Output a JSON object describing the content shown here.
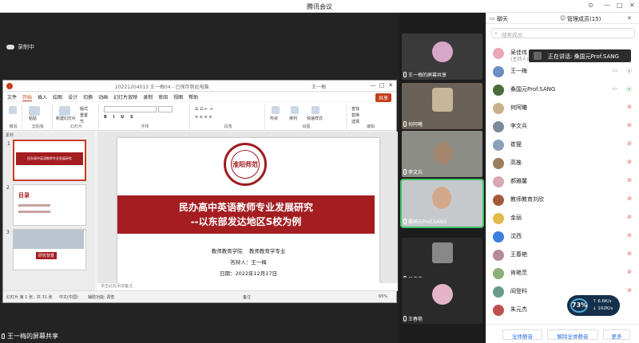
{
  "window": {
    "title": "腾讯会议"
  },
  "recording": "录制中",
  "share_label": "王一梅的屏幕共享",
  "ppt": {
    "file_name": "20221204013 王一梅04 - 已保存到此电脑",
    "user": "王一梅",
    "menu": [
      "文件",
      "开始",
      "插入",
      "绘图",
      "设计",
      "切换",
      "动画",
      "幻灯片放映",
      "录制",
      "审阅",
      "视图",
      "帮助"
    ],
    "active_menu": "开始",
    "share_button": "共享",
    "ribbon_groups": [
      "撤消",
      "剪贴板",
      "幻灯片",
      "字体",
      "段落",
      "绘图",
      "编辑"
    ],
    "ribbon_labels": {
      "paste": "粘贴",
      "new_slide": "新建幻灯片",
      "layout": "版式",
      "reset": "重置",
      "section": "节",
      "shapes": "形状",
      "arrange": "排列",
      "quick_styles": "快速样式",
      "find": "查找",
      "replace": "替换",
      "select": "选择"
    },
    "thumbs_header": "素材",
    "thumbs": [
      {
        "num": "1",
        "text": "民办高中英语教师专业发展研究"
      },
      {
        "num": "2",
        "text": "目录"
      },
      {
        "num": "3",
        "text": "研究背景"
      }
    ],
    "slide": {
      "seal_text": "淮阳师范",
      "title_line1": "民办高中英语教师专业发展研究",
      "title_line2": "--以东部发达地区S校为例",
      "school": "教师教育学院",
      "major": "教师教育学专业",
      "author": "答辩人：王一梅",
      "date": "日期：2022年12月17日"
    },
    "note": "单击此处添加备注",
    "status": {
      "slide": "幻灯片 第 1 张，共 31 张",
      "lang": "中文(中国)",
      "access": "辅助功能: 调查",
      "notes": "备注",
      "zoom": "65%"
    }
  },
  "videos": [
    {
      "name": "王一梅的屏幕共享"
    },
    {
      "name": "何阿曦"
    },
    {
      "name": "李文兵"
    },
    {
      "name": "桑国元Prof.SANG"
    },
    {
      "name": "吴佳伟"
    },
    {
      "name": "王春艳"
    }
  ],
  "panel": {
    "tab_chat": "聊天",
    "tab_members": "管理成员(15)",
    "search_placeholder": "搜索成员",
    "tooltip": "正在讲话: 桑国元Prof.SANG",
    "members": [
      {
        "name": "吴佳伟",
        "sub": "(主持人)",
        "color": "#e9a8b6"
      },
      {
        "name": "王一梅",
        "color": "#6b8fc4"
      },
      {
        "name": "桑国元Prof.SANG",
        "color": "#4a6b3c"
      },
      {
        "name": "何阿曦",
        "color": "#c9b08a"
      },
      {
        "name": "李文兵",
        "color": "#7a8a9a"
      },
      {
        "name": "崔燮",
        "color": "#8aa0b8"
      },
      {
        "name": "高推",
        "color": "#9c7d5b"
      },
      {
        "name": "郝雅馨",
        "color": "#d8a7b1"
      },
      {
        "name": "教师教育刘欣",
        "color": "#a35a3a"
      },
      {
        "name": "金丽",
        "color": "#e0b94a"
      },
      {
        "name": "沈西",
        "color": "#3b7fe0"
      },
      {
        "name": "王春艳",
        "color": "#b58a9a"
      },
      {
        "name": "肯艳灵",
        "color": "#8cb07a"
      },
      {
        "name": "阎登科",
        "color": "#6a9a8a"
      },
      {
        "name": "朱元杰",
        "color": "#c05050"
      }
    ],
    "footer": {
      "mute_all": "全体静音",
      "unmute_all": "解除全体静音",
      "more": "更多"
    }
  },
  "network": {
    "percent": "73%",
    "up": "6.6K/s",
    "down": "102K/s"
  }
}
